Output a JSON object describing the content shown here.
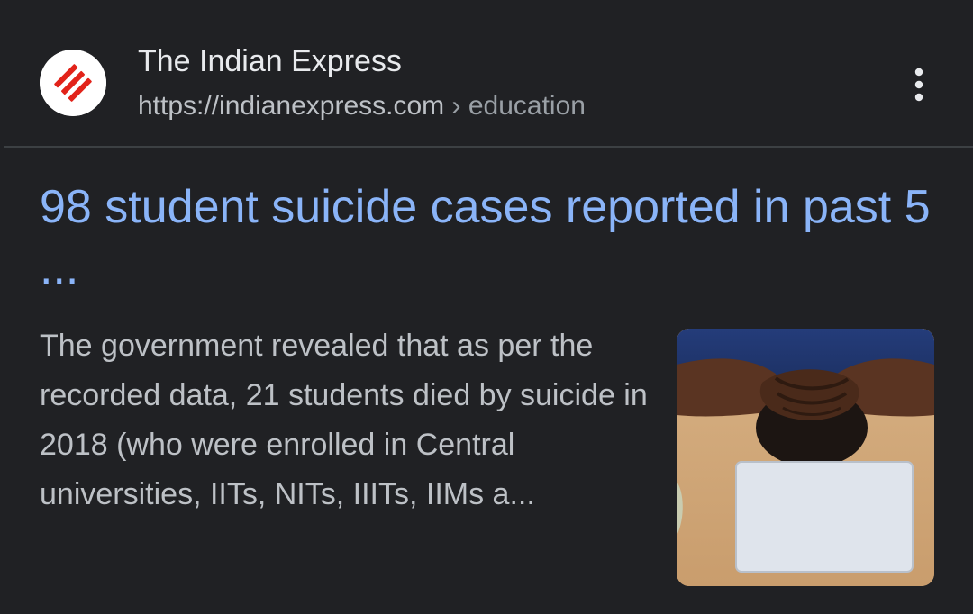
{
  "source": {
    "site_name": "The Indian Express",
    "url_domain": "https://indianexpress.com",
    "url_separator": "›",
    "url_path": "education",
    "favicon": "indian-express-logo-icon"
  },
  "menu": {
    "icon": "more-vert-icon"
  },
  "result": {
    "title": "98 student suicide cases reported in past 5 ...",
    "snippet": "The government revealed that as per the recorded data, 21 students died by suicide in 2018 (who were enrolled in Central universities, IITs, NITs, IIITs, IIMs a...",
    "thumbnail": "student-head-in-hands-image"
  },
  "colors": {
    "background": "#202124",
    "title_link": "#8ab4f8",
    "primary_text": "#e8eaed",
    "secondary_text": "#bdc1c6",
    "brand_red": "#e2231a"
  }
}
